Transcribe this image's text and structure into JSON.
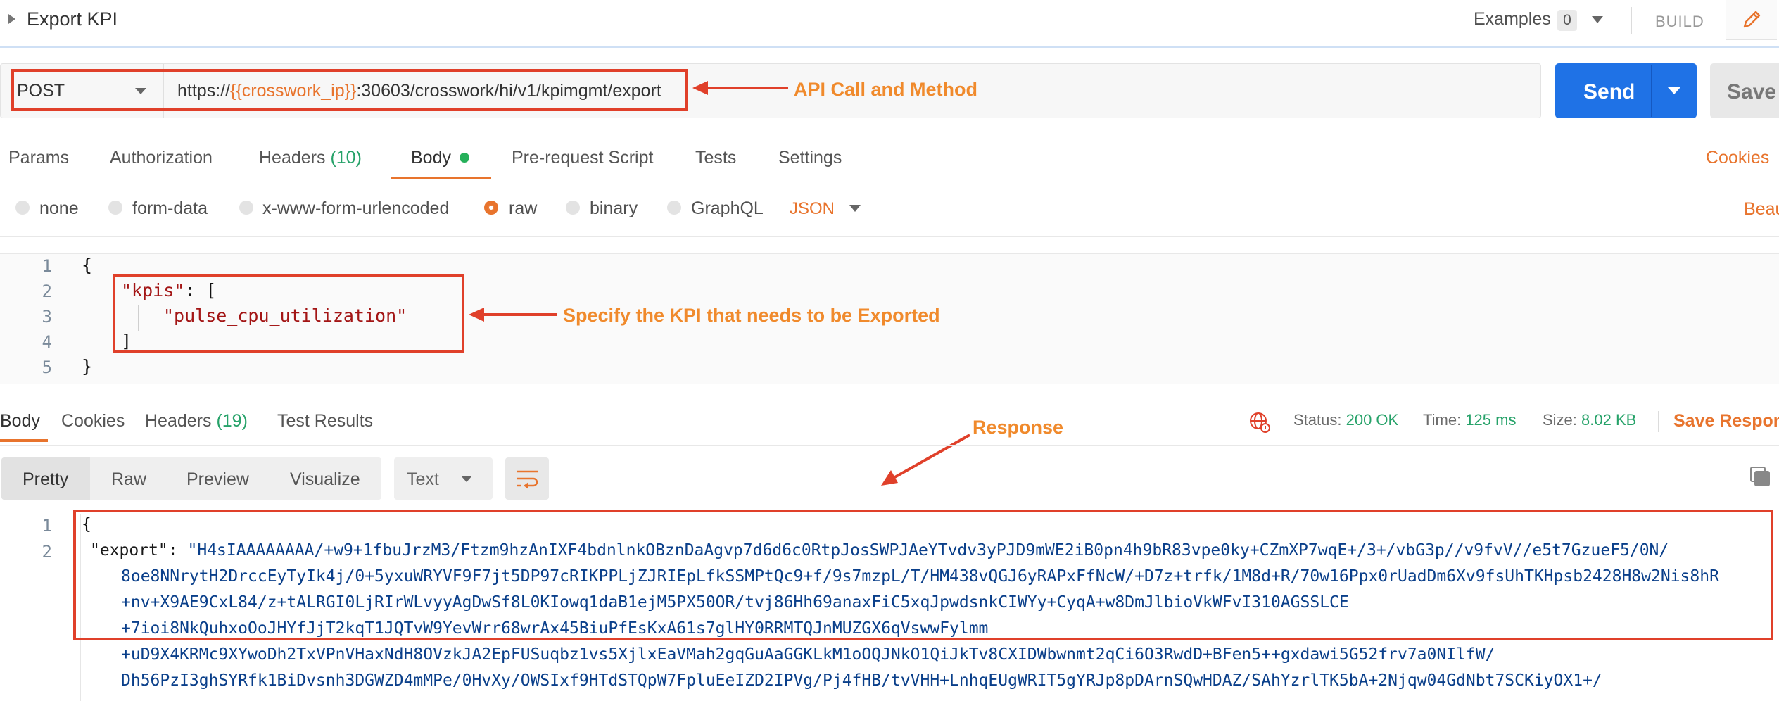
{
  "header": {
    "title": "Export KPI",
    "examples_label": "Examples",
    "examples_count": "0",
    "build_label": "BUILD"
  },
  "request": {
    "method": "POST",
    "url_prefix": "https://",
    "url_variable": "{{crosswork_ip}}",
    "url_suffix": ":30603/crosswork/hi/v1/kpimgmt/export",
    "send_label": "Send",
    "save_label": "Save"
  },
  "request_tabs": {
    "params": "Params",
    "authorization": "Authorization",
    "headers": "Headers",
    "headers_count": "(10)",
    "body": "Body",
    "pre_request": "Pre-request Script",
    "tests": "Tests",
    "settings": "Settings",
    "cookies": "Cookies"
  },
  "body_types": {
    "none": "none",
    "form_data": "form-data",
    "urlencoded": "x-www-form-urlencoded",
    "raw": "raw",
    "binary": "binary",
    "graphql": "GraphQL",
    "format": "JSON",
    "beautify": "Beau"
  },
  "request_body": {
    "line_numbers": [
      "1",
      "2",
      "3",
      "4",
      "5"
    ],
    "open_brace": "{",
    "key": "\"kpis\"",
    "key_suffix": ": [",
    "value": "\"pulse_cpu_utilization\"",
    "close_bracket": "]",
    "close_brace": "}"
  },
  "annotations": {
    "api_call": "API Call and Method",
    "kpi": "Specify the KPI that needs to be Exported",
    "response": "Response"
  },
  "response_tabs": {
    "body": "Body",
    "cookies": "Cookies",
    "headers": "Headers",
    "headers_count": "(19)",
    "test_results": "Test Results"
  },
  "response_status": {
    "status_label": "Status:",
    "status_value": "200 OK",
    "time_label": "Time:",
    "time_value": "125 ms",
    "size_label": "Size:",
    "size_value": "8.02 KB",
    "save_response": "Save Respons"
  },
  "view_modes": {
    "pretty": "Pretty",
    "raw": "Raw",
    "preview": "Preview",
    "visualize": "Visualize",
    "format": "Text"
  },
  "response_body": {
    "line_numbers": [
      "1",
      "2"
    ],
    "open_brace": "{",
    "export_key": "\"export\"",
    "export_sep": ": ",
    "lines": [
      "\"H4sIAAAAAAAA/+w9+1fbuJrzM3/Ftzm9hzAnIXF4bdnlnkOBznDaAgvp7d6d6c0RtpJosSWPJAeYTvdv3yPJD9mWE2iB0pn4h9bR83vpe0ky+CZmXP7wqE+/3+/vbG3p//v9fvV//e5t7GzueF5/0N/",
      "8oe8NNrytH2DrccEyTyIk4j/0+5yxuWRYVF9F7jt5DP97cRIKPPLjZJRIEpLfkSSMPtQc9+f/9s7mzpL/T/HM438vQGJ6yRAPxFfNcW/+D7z+trfk/1M8d+R/70w16Ppx0rUadDm6Xv9fsUhTKHpsb2428H8w2Nis8hR",
      "+nv+X9AE9CxL84/z+tALRGI0LjRIrWLvyyAgDwSf8L0KIowq1daB1ejM5PX50OR/tvj86Hh69anaxFiC5xqJpwdsnkCIWYy+CyqA+w8DmJlbioVkWFvI310AGSSLCE",
      "+7ioi8NkQuhxoOoJHYfJjT2kqT1JQTvW9YevWrr68wrAx45BiuPfEsKxA61s7glHY0RRMTQJnMUZGX6qVswwFylmm",
      "+uD9X4KRMc9XYwoDh2TxVPnVHaxNdH8OVzkJA2EpFUSuqbz1vs5XjlxEaVMah2gqGuAaGGKLkM1oOQJNkO1QiJkTv8CXIDWbwnmt2qCi6O3RwdD+BFen5++gxdawi5G52frv7a0NIlfW/",
      "Dh56PzI3ghSYRfk1BiDvsnh3DGWZD4mMPe/0HvXy/OWSIxf9HTdSTQpW7FpluEeIZD2IPVg/Pj4fHB/tvVHH+LnhqEUgWRIT5gYRJp8pDArnSQwHDAZ/SAhYzrlTK5bA+2Njqw04GdNbt7SCKiyOX1+/"
    ]
  }
}
